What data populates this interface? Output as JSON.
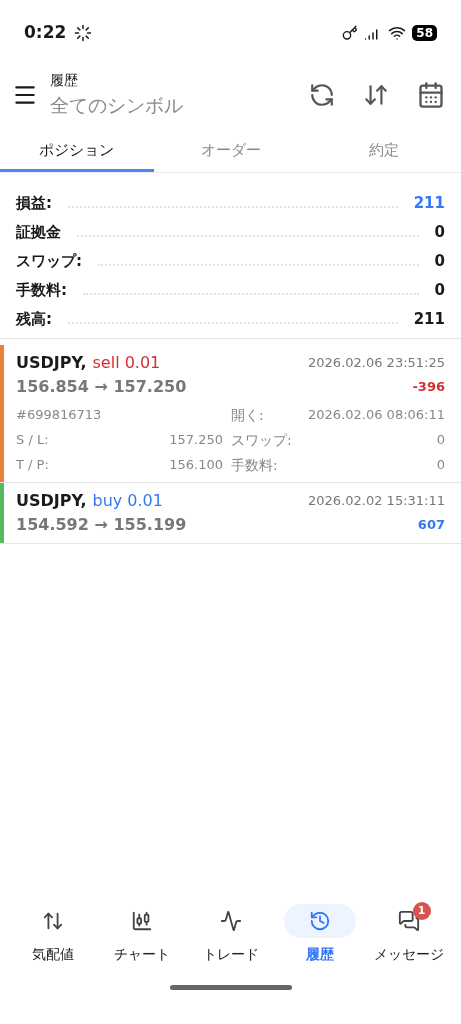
{
  "status_bar": {
    "time": "0:22",
    "battery": "58"
  },
  "header": {
    "title": "履歴",
    "subtitle": "全てのシンボル"
  },
  "tabs": [
    {
      "label": "ポジション",
      "selected": true
    },
    {
      "label": "オーダー",
      "selected": false
    },
    {
      "label": "約定",
      "selected": false
    }
  ],
  "summary": [
    {
      "label": "損益:",
      "value": "211",
      "highlighted": true
    },
    {
      "label": "証拠金",
      "value": "0",
      "highlighted": false
    },
    {
      "label": "スワップ:",
      "value": "0",
      "highlighted": false
    },
    {
      "label": "手数料:",
      "value": "0",
      "highlighted": false
    },
    {
      "label": "残高:",
      "value": "211",
      "highlighted": false
    }
  ],
  "positions": [
    {
      "symbol": "USDJPY,",
      "kind": "sell",
      "action": "sell 0.01",
      "prices": "156.854 → 157.250",
      "time": "2026.02.06 23:51:25",
      "profit": "-396",
      "expanded": true,
      "ticket": "#699816713",
      "open_label": "開く:",
      "open_time": "2026.02.06 08:06:11",
      "sl_label": "S / L:",
      "sl": "157.250",
      "swap_label": "スワップ:",
      "swap": "0",
      "tp_label": "T / P:",
      "tp": "156.100",
      "fee_label": "手数料:",
      "fee": "0"
    },
    {
      "symbol": "USDJPY,",
      "kind": "buy",
      "action": "buy 0.01",
      "prices": "154.592 → 155.199",
      "time": "2026.02.02 15:31:11",
      "profit": "607",
      "expanded": false
    }
  ],
  "bottom_nav": [
    {
      "kind": "quotes",
      "label": "気配値",
      "selected": false
    },
    {
      "kind": "chart",
      "label": "チャート",
      "selected": false
    },
    {
      "kind": "trade",
      "label": "トレード",
      "selected": false
    },
    {
      "kind": "history",
      "label": "履歴",
      "selected": true
    },
    {
      "kind": "messages",
      "label": "メッセージ",
      "selected": false,
      "badge": "1"
    }
  ]
}
